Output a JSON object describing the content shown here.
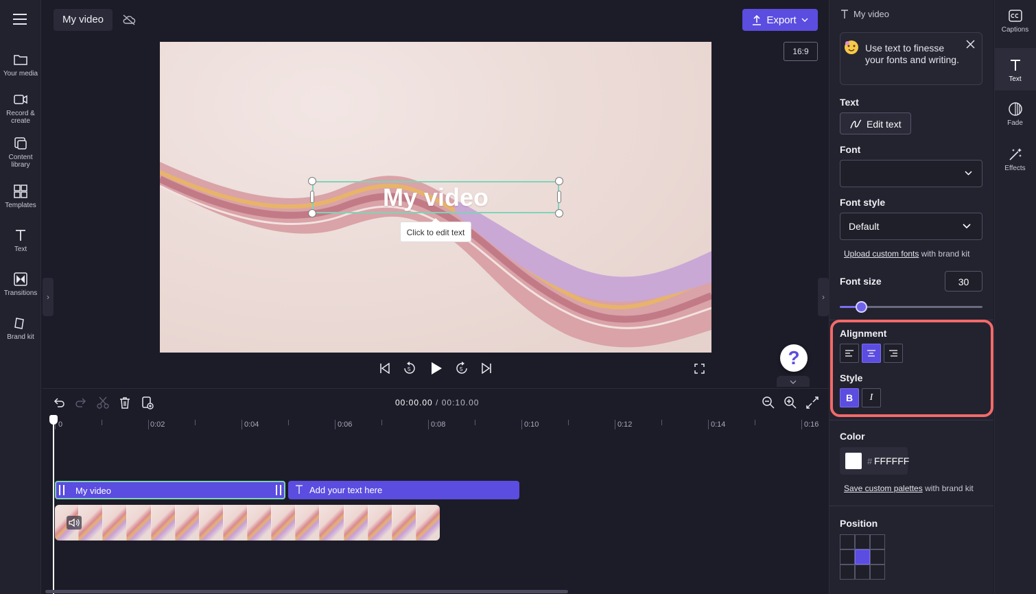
{
  "app": {
    "project_title": "My video",
    "export_label": "Export",
    "aspect_ratio": "16:9"
  },
  "left_nav": {
    "items": [
      {
        "label": "Your media",
        "icon": "folder-icon"
      },
      {
        "label": "Record & create",
        "icon": "camera-icon"
      },
      {
        "label": "Content library",
        "icon": "library-icon"
      },
      {
        "label": "Templates",
        "icon": "templates-icon"
      },
      {
        "label": "Text",
        "icon": "text-icon"
      },
      {
        "label": "Transitions",
        "icon": "transitions-icon"
      },
      {
        "label": "Brand kit",
        "icon": "brand-kit-icon"
      }
    ]
  },
  "preview": {
    "overlay_text": "My video",
    "tooltip": "Click to edit text",
    "help_label": "?"
  },
  "timeline": {
    "current_time": "00:00.00",
    "separator": " / ",
    "total_time": "00:10.00",
    "ruler_labels": [
      "0",
      "0:02",
      "0:04",
      "0:06",
      "0:08",
      "0:10",
      "0:12",
      "0:14",
      "0:16"
    ],
    "text_clips": [
      "My video",
      "Add your text here"
    ]
  },
  "right_panel": {
    "header": "My video",
    "tip_text": "Use text to finesse your fonts and writing.",
    "text_section_label": "Text",
    "edit_text_label": "Edit text",
    "font_label": "Font",
    "font_value": "",
    "font_style_label": "Font style",
    "font_style_value": "Default",
    "upload_fonts_link": "Upload custom fonts",
    "upload_fonts_suffix": " with brand kit",
    "font_size_label": "Font size",
    "font_size_value": "30",
    "font_size_level": 0.15,
    "alignment_label": "Alignment",
    "alignment_selected": "center",
    "style_label": "Style",
    "bold_label": "B",
    "italic_label": "I",
    "color_label": "Color",
    "color_hash": "#",
    "color_value": "FFFFFF",
    "save_palettes_link": "Save custom palettes",
    "save_palettes_suffix": " with brand kit",
    "position_label": "Position",
    "position_selected": "center"
  },
  "tool_rail": {
    "items": [
      {
        "label": "Captions",
        "icon": "captions-icon"
      },
      {
        "label": "Text",
        "icon": "text-icon",
        "active": true
      },
      {
        "label": "Fade",
        "icon": "fade-icon"
      },
      {
        "label": "Effects",
        "icon": "effects-icon"
      }
    ]
  },
  "colors": {
    "accent": "#5b4de0",
    "highlight": "#f36a6a",
    "selection": "#7ed4b8"
  }
}
